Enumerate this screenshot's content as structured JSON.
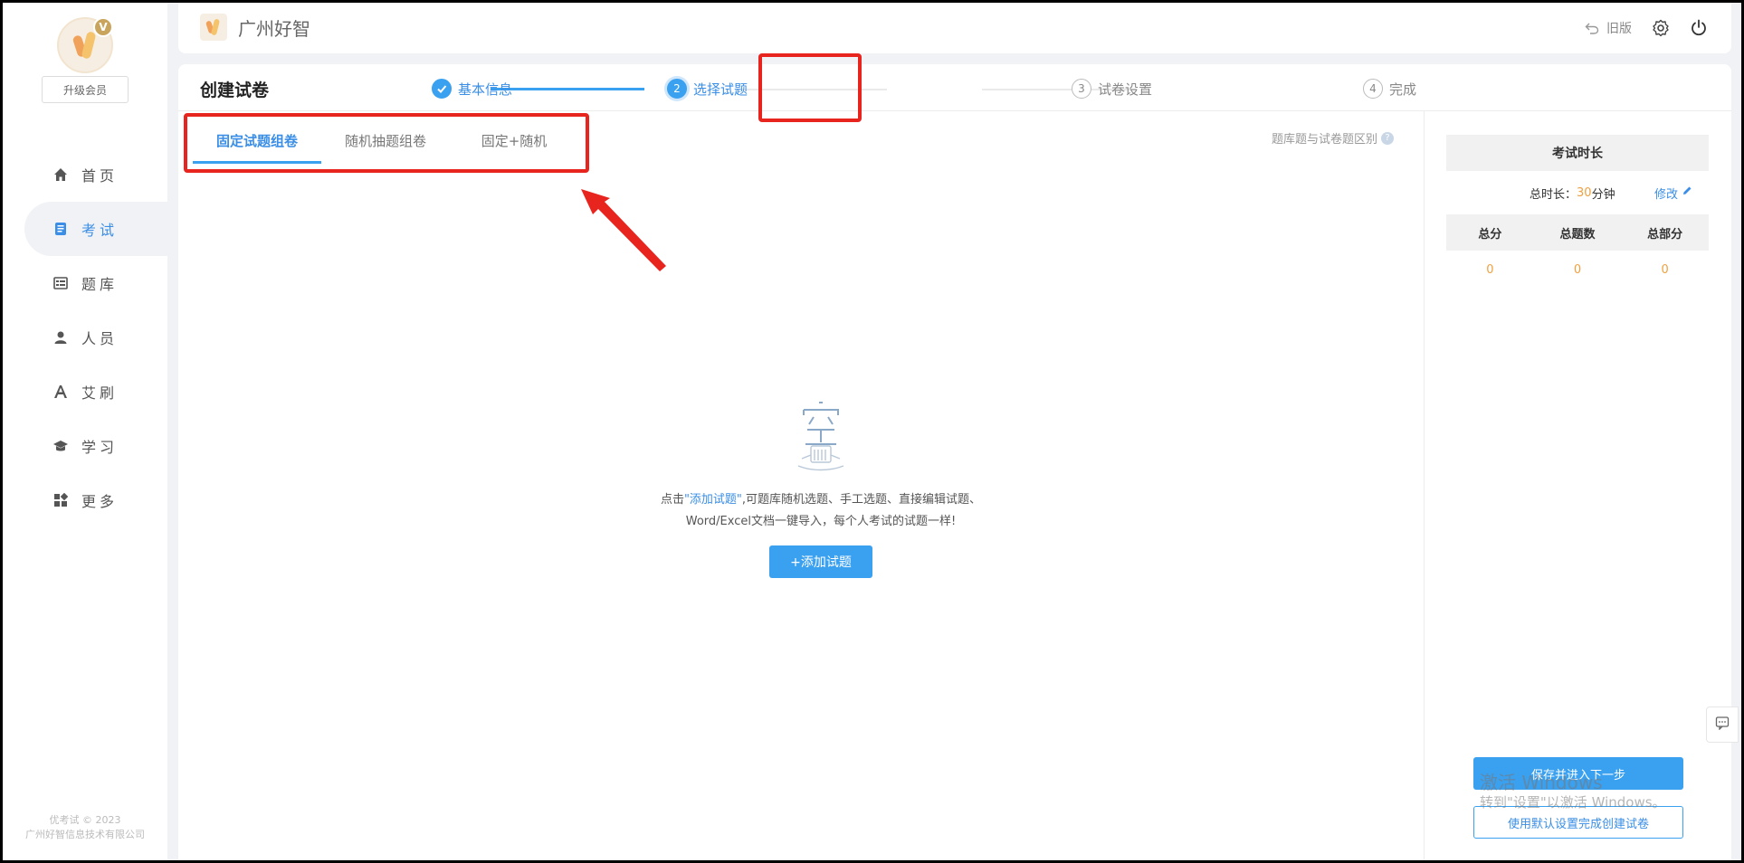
{
  "sidebar": {
    "vip_badge": "V",
    "upgrade_label": "升级会员",
    "items": [
      {
        "id": "home",
        "label": "首页",
        "icon": "home-icon",
        "active": false
      },
      {
        "id": "exam",
        "label": "考试",
        "icon": "document-icon",
        "active": true
      },
      {
        "id": "bank",
        "label": "题库",
        "icon": "list-icon",
        "active": false
      },
      {
        "id": "people",
        "label": "人员",
        "icon": "user-icon",
        "active": false
      },
      {
        "id": "brush",
        "label": "艾刷",
        "icon": "letter-a-icon",
        "active": false
      },
      {
        "id": "study",
        "label": "学习",
        "icon": "graduation-cap-icon",
        "active": false
      },
      {
        "id": "more",
        "label": "更多",
        "icon": "apps-grid-icon",
        "active": false
      }
    ],
    "footer_line1": "优考试 © 2023",
    "footer_line2": "广州好智信息技术有限公司"
  },
  "header": {
    "brand": "广州好智",
    "old_version": "旧版"
  },
  "page": {
    "title": "创建试卷",
    "steps": [
      {
        "num": "✓",
        "label": "基本信息",
        "state": "done"
      },
      {
        "num": "2",
        "label": "选择试题",
        "state": "current"
      },
      {
        "num": "3",
        "label": "试卷设置",
        "state": "todo"
      },
      {
        "num": "4",
        "label": "完成",
        "state": "todo"
      }
    ],
    "tabs": [
      {
        "label": "固定试题组卷",
        "active": true
      },
      {
        "label": "随机抽题组卷",
        "active": false
      },
      {
        "label": "固定+随机",
        "active": false
      }
    ],
    "diff_link": "题库题与试卷题区别",
    "help_glyph": "?"
  },
  "empty_state": {
    "text_prefix": "点击",
    "text_link": "\"添加试题\"",
    "text_suffix": ",可题库随机选题、手工选题、直接编辑试题、",
    "text_line2": "Word/Excel文档一键导入，每个人考试的试题一样!",
    "add_button": "+添加试题"
  },
  "right_panel": {
    "duration_header": "考试时长",
    "total_label": "总时长：",
    "total_value": "30",
    "total_unit": "分钟",
    "edit_label": "修改",
    "stats_headers": [
      "总分",
      "总题数",
      "总部分"
    ],
    "stats_values": [
      "0",
      "0",
      "0"
    ],
    "save_next": "保存并进入下一步",
    "use_default": "使用默认设置完成创建试卷"
  },
  "watermark": {
    "line1": "激活 Windows",
    "line2": "转到\"设置\"以激活 Windows。"
  },
  "colors": {
    "accent": "#3aa0f0",
    "highlight": "#e8241e",
    "orange": "#f0a040"
  }
}
